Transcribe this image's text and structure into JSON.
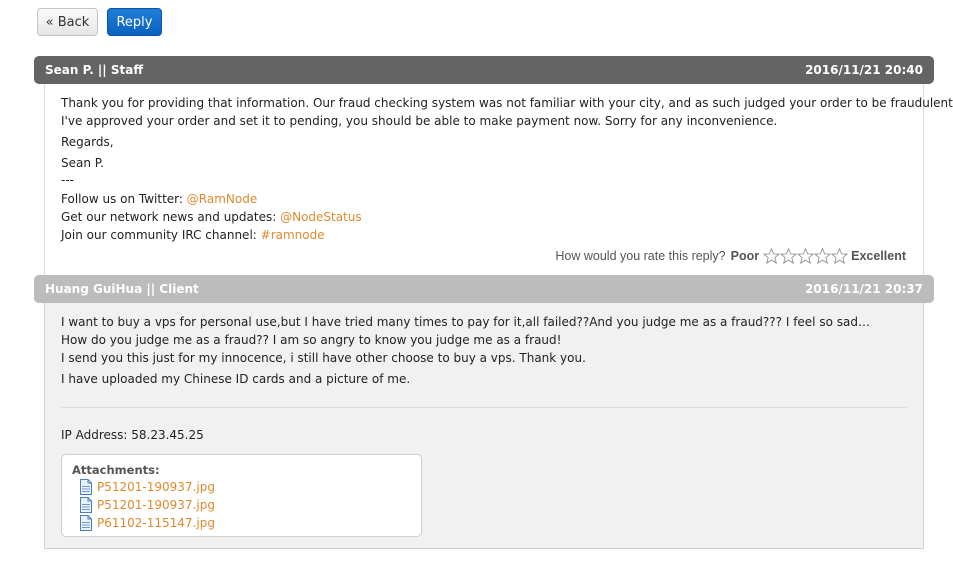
{
  "toolbar": {
    "back_label": "« Back",
    "reply_label": "Reply"
  },
  "messages": [
    {
      "author": "Sean P. || Staff",
      "timestamp": "2016/11/21 20:40",
      "lines": [
        "Thank you for providing that information. Our fraud checking system was not familiar with your city, and as such judged your order to be fraudulent.",
        "I've approved your order and set it to pending, you should be able to make payment now. Sorry for any inconvenience.",
        "Regards,",
        "Sean P.",
        "---"
      ],
      "links": [
        {
          "prefix": "Follow us on Twitter: ",
          "text": "@RamNode"
        },
        {
          "prefix": "Get our network news and updates: ",
          "text": "@NodeStatus"
        },
        {
          "prefix": "Join our community IRC channel: ",
          "text": "#ramnode"
        }
      ],
      "rating": {
        "prompt": "How would you rate this reply?",
        "low_label": "Poor",
        "high_label": "Excellent",
        "stars": 5
      }
    },
    {
      "author": "Huang GuiHua || Client",
      "timestamp": "2016/11/21 20:37",
      "lines": [
        "I want to buy a vps for personal use,but I have tried many times to pay for it,all failed??And you judge me as a fraud??? I feel so sad…",
        "How do you judge me as a fraud?? I am so angry to know you judge me as a fraud!",
        "I send you this just for my innocence, i still have other choose to buy a vps. Thank you.",
        "I have uploaded my Chinese ID cards and a picture of me."
      ],
      "ip_address": "IP Address: 58.23.45.25",
      "attachments_label": "Attachments:",
      "attachments": [
        "P51201-190937.jpg",
        "P51201-190937.jpg",
        "P61102-115147.jpg"
      ]
    }
  ],
  "colors": {
    "link": "#e08a2e",
    "staff_header": "#646464",
    "client_header": "#bcbcbc",
    "reply_button": "#0b62c0"
  },
  "icons": {
    "rating": "star-outline-icon",
    "attachment": "file-icon"
  }
}
